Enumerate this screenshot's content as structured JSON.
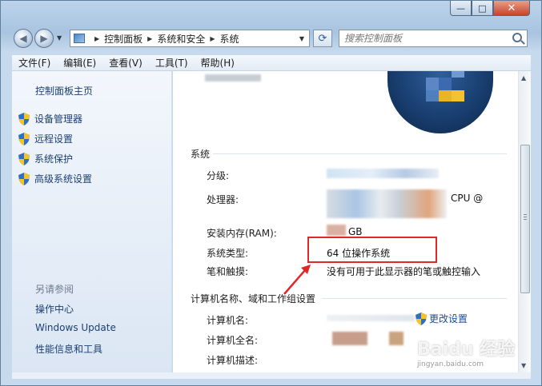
{
  "window": {
    "title": "",
    "controls": {
      "minimize": "—",
      "maximize": "□",
      "close": "✕"
    }
  },
  "nav": {
    "breadcrumbs": [
      "控制面板",
      "系统和安全",
      "系统"
    ],
    "search_placeholder": "搜索控制面板"
  },
  "menubar": {
    "items": [
      "文件(F)",
      "编辑(E)",
      "查看(V)",
      "工具(T)",
      "帮助(H)"
    ]
  },
  "sidebar": {
    "home": "控制面板主页",
    "links": [
      "设备管理器",
      "远程设置",
      "系统保护",
      "高级系统设置"
    ],
    "see_also_heading": "另请参阅",
    "see_also": [
      "操作中心",
      "Windows Update",
      "性能信息和工具"
    ]
  },
  "system": {
    "heading": "系统",
    "rating_label": "分级:",
    "processor_label": "处理器:",
    "processor_value_tail": "CPU @",
    "ram_label": "安装内存(RAM):",
    "ram_value_tail": "GB",
    "type_label": "系统类型:",
    "type_value": "64 位操作系统",
    "pen_label": "笔和触摸:",
    "pen_value": "没有可用于此显示器的笔或触控输入"
  },
  "computer": {
    "heading": "计算机名称、域和工作组设置",
    "name_label": "计算机名:",
    "fullname_label": "计算机全名:",
    "desc_label": "计算机描述:",
    "change_link": "更改设置"
  },
  "watermark": {
    "main": "Baidu 经验",
    "sub": "jingyan.baidu.com"
  },
  "colors": {
    "link": "#1c3f72",
    "highlight": "#e2272b"
  }
}
